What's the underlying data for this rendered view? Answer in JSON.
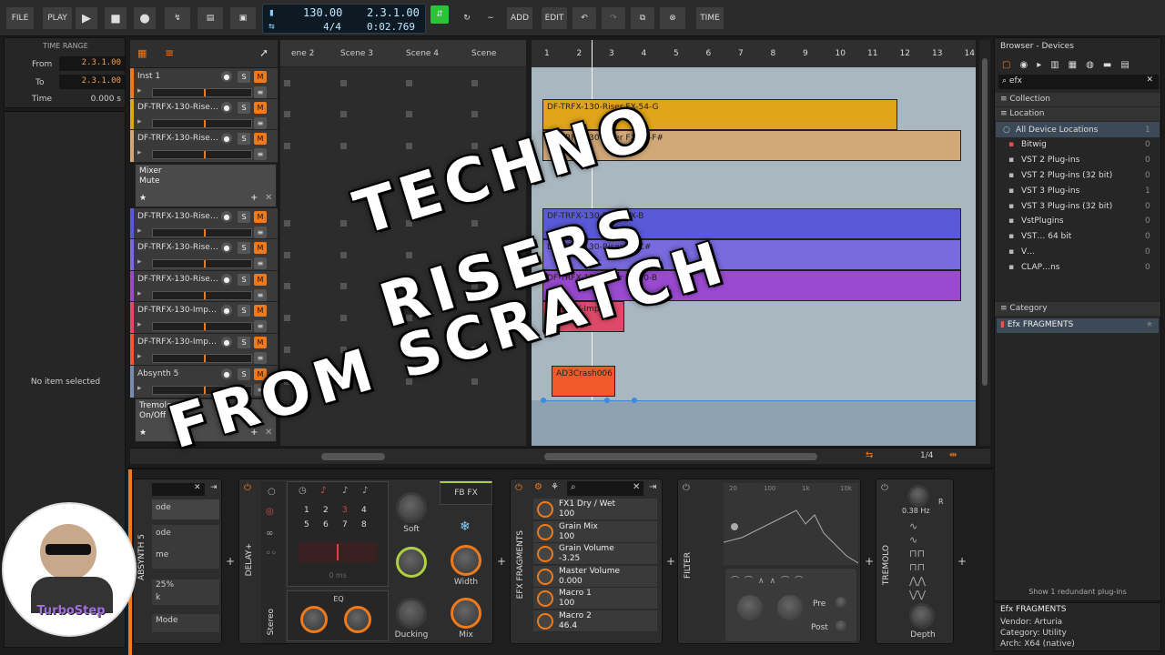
{
  "toolbar": {
    "file": "FILE",
    "play": "PLAY",
    "add": "ADD",
    "edit": "EDIT",
    "time": "TIME",
    "tempo": "130.00",
    "meter": "4/4",
    "position": "2.3.1.00",
    "time_pos": "0:02.769"
  },
  "time_range": {
    "title": "TIME RANGE",
    "from_label": "From",
    "from_value": "2.3.1.00",
    "to_label": "To",
    "to_value": "2.3.1.00",
    "time_label": "Time",
    "time_value": "0.000 s"
  },
  "inspector": {
    "empty": "No item selected"
  },
  "tracks": [
    {
      "name": "Inst 1",
      "color": "#f07a1a"
    },
    {
      "name": "DF-TRFX-130-Rise…",
      "color": "#e0a51a"
    },
    {
      "name": "DF-TRFX-130-Rise…",
      "color": "#d2a878"
    },
    {
      "name": "DF-TRFX-130-Rise…",
      "color": "#5a5ad8"
    },
    {
      "name": "DF-TRFX-130-Rise…",
      "color": "#7a6ae0"
    },
    {
      "name": "DF-TRFX-130-Rise…",
      "color": "#9a4ad0"
    },
    {
      "name": "DF-TRFX-130-Imp…",
      "color": "#e04a6a"
    },
    {
      "name": "DF-TRFX-130-Imp…",
      "color": "#f05a2a"
    },
    {
      "name": "Absynth 5",
      "color": "#7a8ab0"
    }
  ],
  "track_buttons": {
    "solo": "S",
    "mute": "M"
  },
  "mixer_popup": {
    "title": "Mixer",
    "sub": "Mute"
  },
  "tremolo_popup": {
    "title": "Tremolo",
    "sub": "On/Off"
  },
  "scenes": [
    "ene 2",
    "Scene 3",
    "Scene 4",
    "Scene"
  ],
  "ruler": [
    "1",
    "2",
    "3",
    "4",
    "5",
    "6",
    "7",
    "8",
    "9",
    "10",
    "11",
    "12",
    "13",
    "14"
  ],
  "clips": [
    {
      "label": "DF-TRFX-130-Riser FX-54-G",
      "color": "#e0a51a"
    },
    {
      "label": "DF-TRFX-130-Riser FX-53-F#",
      "color": "#d2a878"
    },
    {
      "label": "DF-TRFX-130-Riser FX-B",
      "color": "#5a5ad8"
    },
    {
      "label": "DF-TRFX-130-Riser FX-C#",
      "color": "#7a6ae0"
    },
    {
      "label": "DF-TRFX-130-Riser FX-10-B",
      "color": "#9a4ad0"
    },
    {
      "label": "DF-TRFX-Imp",
      "color": "#e04a6a"
    },
    {
      "label": "AD3Crash006",
      "color": "#f05a2a"
    }
  ],
  "zoom": "1/4",
  "browser": {
    "title": "Browser - Devices",
    "search": "efx",
    "collection": "Collection",
    "location": "Location",
    "locations": [
      {
        "name": "All Device Locations",
        "count": "1"
      },
      {
        "name": "Bitwig",
        "count": "0"
      },
      {
        "name": "VST 2 Plug-ins",
        "count": "0"
      },
      {
        "name": "VST 2 Plug-ins (32 bit)",
        "count": "0"
      },
      {
        "name": "VST 3 Plug-ins",
        "count": "1"
      },
      {
        "name": "VST 3 Plug-ins (32 bit)",
        "count": "0"
      },
      {
        "name": "VstPlugins",
        "count": "0"
      },
      {
        "name": "VST… 64 bit",
        "count": "0"
      },
      {
        "name": "V…",
        "count": "0"
      },
      {
        "name": "CLAP…ns",
        "count": "0"
      }
    ],
    "category": "Category",
    "result": "Efx FRAGMENTS",
    "redundant": "Show 1 redundant plug-ins",
    "info_title": "Efx FRAGMENTS",
    "vendor": "Vendor: Arturia",
    "category_info": "Category: Utility",
    "arch": "Arch: X64 (native)"
  },
  "devices": {
    "absynth": {
      "name": "ABSYNTH 5",
      "rows": [
        "ode",
        "ode",
        "me",
        "25%",
        "k",
        "Mode"
      ]
    },
    "delay": {
      "name": "DELAY+",
      "stereo": "Stereo",
      "delay_time": "0 ms",
      "eq": "EQ",
      "fb_fx": "FB FX",
      "soft": "Soft",
      "width": "Width",
      "ducking": "Ducking",
      "mix": "Mix",
      "grid": [
        "1",
        "2",
        "3",
        "4",
        "5",
        "6",
        "7",
        "8"
      ]
    },
    "efx": {
      "name": "EFX FRAGMENTS",
      "params": [
        {
          "name": "FX1 Dry / Wet",
          "value": "100"
        },
        {
          "name": "Grain Mix",
          "value": "100"
        },
        {
          "name": "Grain Volume",
          "value": "-3.25"
        },
        {
          "name": "Master Volume",
          "value": "0.000"
        },
        {
          "name": "Macro 1",
          "value": "100"
        },
        {
          "name": "Macro 2",
          "value": "46.4"
        }
      ]
    },
    "filter": {
      "name": "FILTER",
      "freqs": [
        "20",
        "100",
        "1k",
        "10k"
      ],
      "pre": "Pre",
      "post": "Post"
    },
    "tremolo": {
      "name": "TREMOLO",
      "rate": "0.38 Hz",
      "r": "R",
      "depth": "Depth"
    }
  },
  "overlay": {
    "line1": "TECHNO",
    "line2": "RISERS",
    "line3": "FROM SCRATCH"
  },
  "channel_logo": "TurboStep"
}
